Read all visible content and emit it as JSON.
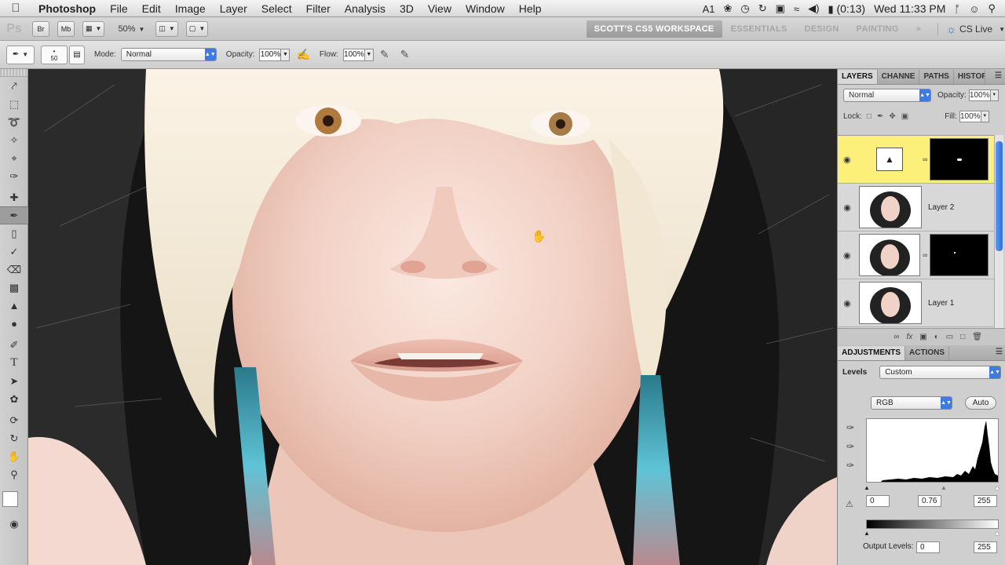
{
  "menubar": {
    "apple": "",
    "items": [
      "Photoshop",
      "File",
      "Edit",
      "Image",
      "Layer",
      "Select",
      "Filter",
      "Analysis",
      "3D",
      "View",
      "Window",
      "Help"
    ],
    "status": {
      "adobe_badge": "1",
      "battery": "(0:13)",
      "clock": "Wed 11:33 PM"
    }
  },
  "appbar": {
    "ps_logo": "Ps",
    "bridge": "Br",
    "minibridge": "Mb",
    "zoom": "50%",
    "workspaces": {
      "active": "SCOTT'S CS5 WORKSPACE",
      "others": [
        "ESSENTIALS",
        "DESIGN",
        "PAINTING"
      ],
      "more": "»"
    },
    "cslive": "CS Live"
  },
  "options": {
    "brush_size": "50",
    "mode_label": "Mode:",
    "mode_value": "Normal",
    "opacity_label": "Opacity:",
    "opacity_value": "100%",
    "flow_label": "Flow:",
    "flow_value": "100%"
  },
  "tools": [
    "move",
    "marquee",
    "lasso",
    "quick-select",
    "crop",
    "eyedropper",
    "healing",
    "brush",
    "clone",
    "history-brush",
    "eraser",
    "gradient",
    "blur",
    "dodge",
    "pen",
    "type",
    "path-select",
    "shape",
    "3d-rotate",
    "3d-orbit",
    "hand",
    "zoom"
  ],
  "layers_panel": {
    "tabs": [
      "LAYERS",
      "CHANNE",
      "PATHS",
      "HISTORY"
    ],
    "blend_mode": "Normal",
    "opacity_label": "Opacity:",
    "opacity_value": "100%",
    "lock_label": "Lock:",
    "fill_label": "Fill:",
    "fill_value": "100%",
    "layers": [
      {
        "name": "",
        "type": "levels-adjustment",
        "selected": true,
        "has_mask": true
      },
      {
        "name": "Layer 2",
        "type": "pixel",
        "selected": false,
        "has_mask": false
      },
      {
        "name": "",
        "type": "pixel",
        "selected": false,
        "has_mask": true
      },
      {
        "name": "Layer 1",
        "type": "pixel",
        "selected": false,
        "has_mask": false
      }
    ]
  },
  "adjustments_panel": {
    "tabs": [
      "ADJUSTMENTS",
      "ACTIONS"
    ],
    "title": "Levels",
    "preset": "Custom",
    "channel": "RGB",
    "auto_label": "Auto",
    "input_black": "0",
    "input_gamma": "0.76",
    "input_white": "255",
    "output_label": "Output Levels:",
    "output_black": "0",
    "output_white": "255"
  },
  "colors": {
    "foreground": "#ffffff",
    "background": "#000000",
    "selected_layer": "#fdf07a",
    "workspace_active": "#a9a9a9"
  }
}
